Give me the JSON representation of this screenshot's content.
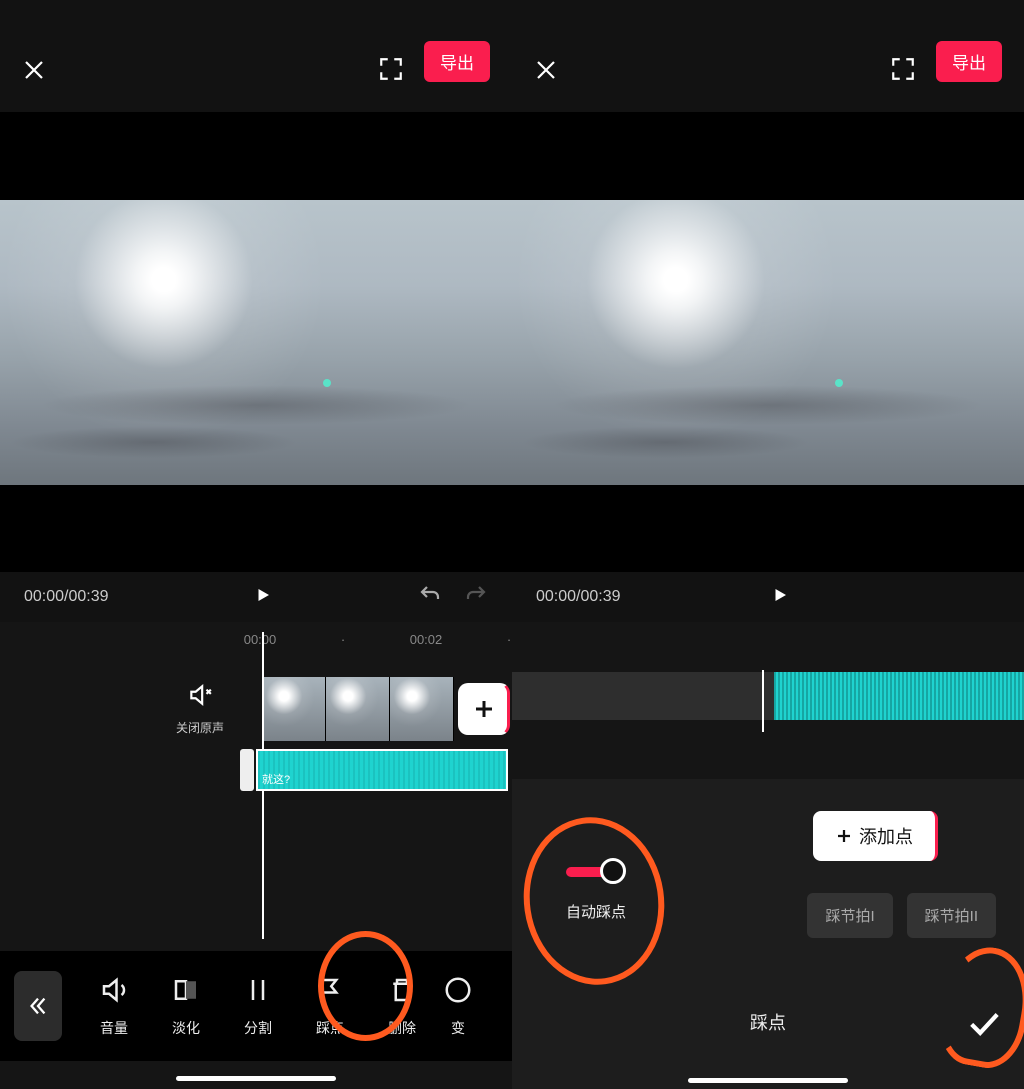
{
  "header": {
    "export_label": "导出"
  },
  "transport": {
    "left_time": "00:00/00:39",
    "right_time": "00:00/00:39"
  },
  "ruler": {
    "t0": "00:00",
    "t1": "00:02"
  },
  "mute": {
    "label": "关闭原声"
  },
  "audio_clip": {
    "tag": "就这?"
  },
  "toolbar": {
    "volume": "音量",
    "fade": "淡化",
    "split": "分割",
    "beat": "踩点",
    "delete": "删除",
    "speed": "变"
  },
  "beat_panel": {
    "add_point": "添加点",
    "auto_label": "自动踩点",
    "opt1": "踩节拍I",
    "opt2": "踩节拍II",
    "title": "踩点"
  }
}
